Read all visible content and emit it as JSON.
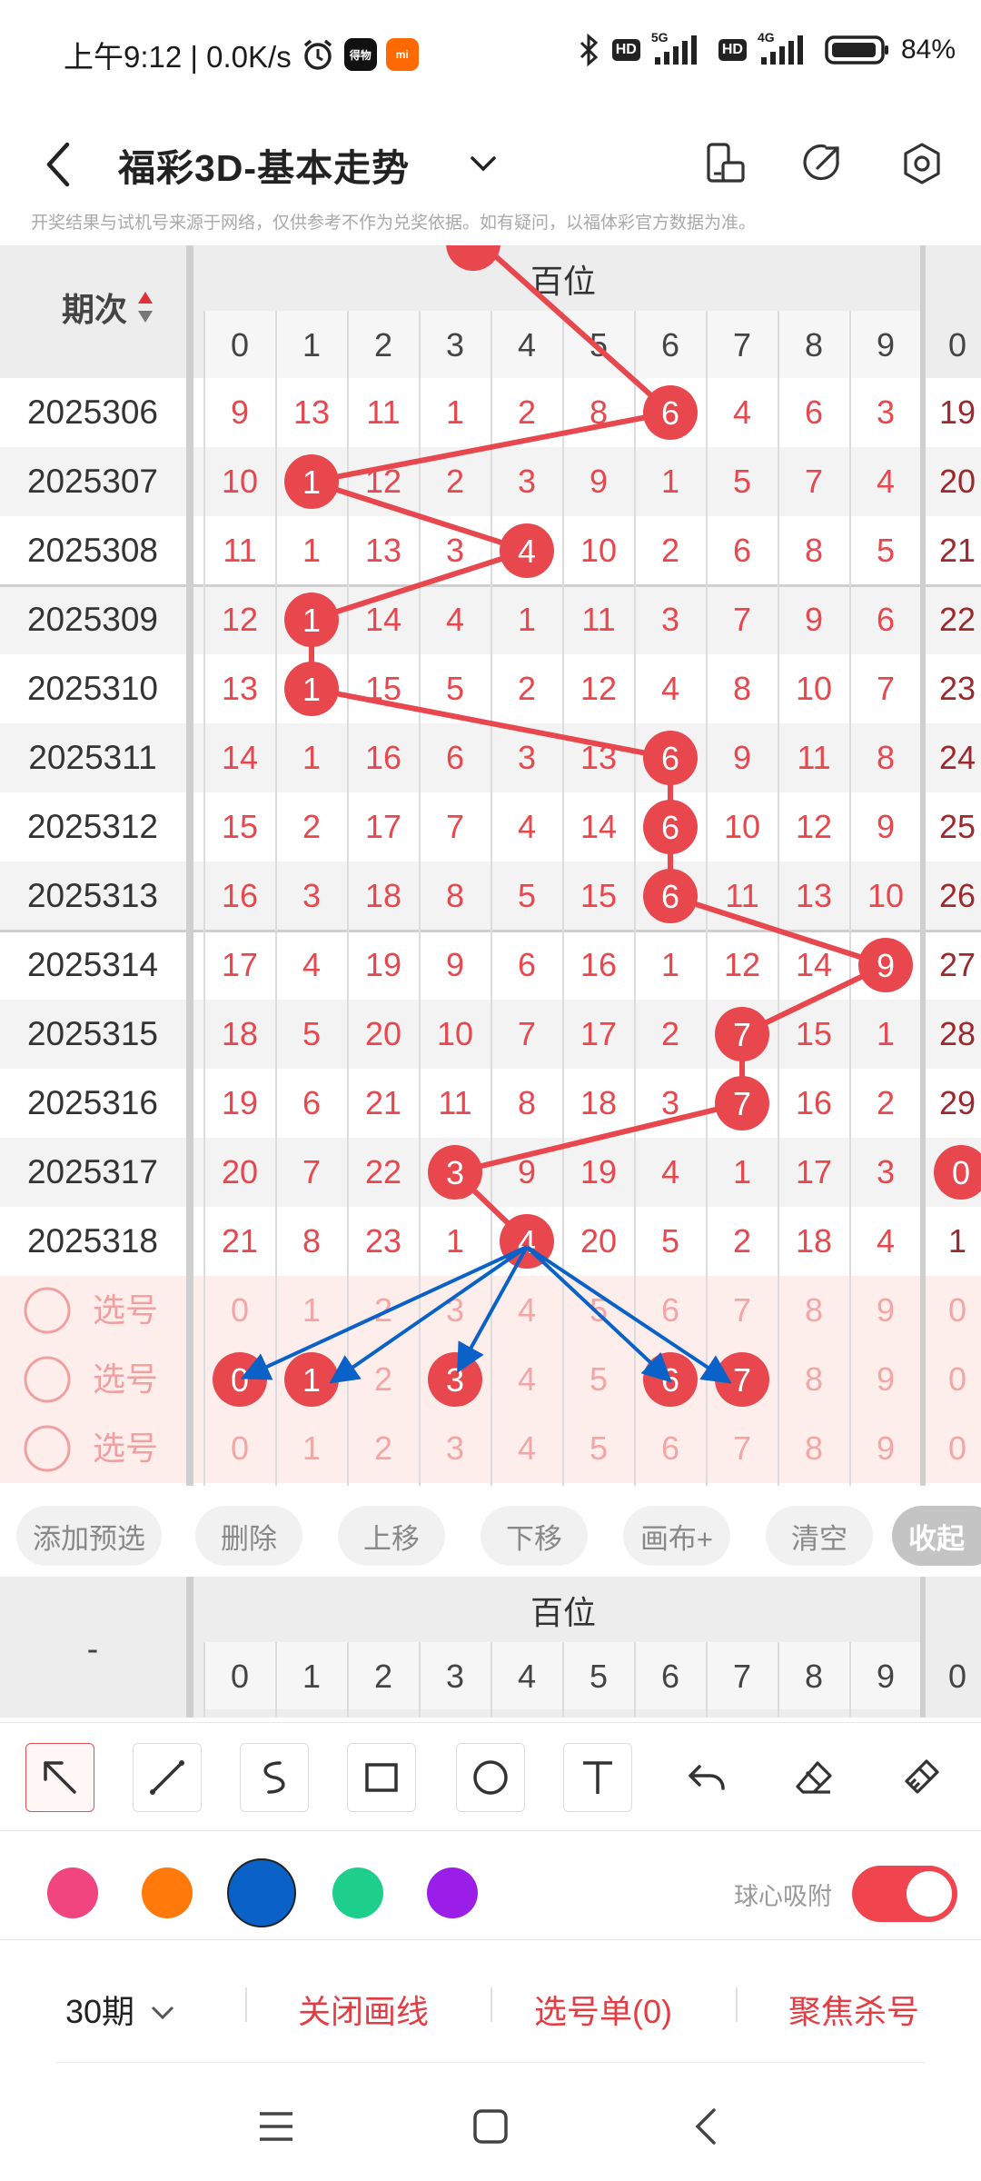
{
  "status": {
    "time": "上午9:12 | 0.0K/s",
    "app1": "得物",
    "app2": "mi",
    "net5g": "5G",
    "net4g": "4G",
    "hd": "HD",
    "battery": "84%"
  },
  "header": {
    "title": "福彩3D-基本走势"
  },
  "notice": "开奖结果与试机号来源于网络，仅供参考不作为兑奖依据。如有疑问，以福体彩官方数据为准。",
  "grid": {
    "period_label": "期次",
    "section_label": "百位",
    "digits": [
      "0",
      "1",
      "2",
      "3",
      "4",
      "5",
      "6",
      "7",
      "8",
      "9"
    ],
    "next_col_digit": "0",
    "rows": [
      {
        "p": "2025306",
        "v": [
          "9",
          "13",
          "11",
          "1",
          "2",
          "8",
          "6",
          "4",
          "6",
          "3"
        ],
        "hit": 6,
        "n": "19"
      },
      {
        "p": "2025307",
        "v": [
          "10",
          "1",
          "12",
          "2",
          "3",
          "9",
          "1",
          "5",
          "7",
          "4"
        ],
        "hit": 1,
        "n": "20"
      },
      {
        "p": "2025308",
        "v": [
          "11",
          "1",
          "13",
          "3",
          "4",
          "10",
          "2",
          "6",
          "8",
          "5"
        ],
        "hit": 4,
        "n": "21"
      },
      {
        "p": "2025309",
        "v": [
          "12",
          "1",
          "14",
          "4",
          "1",
          "11",
          "3",
          "7",
          "9",
          "6"
        ],
        "hit": 1,
        "n": "22"
      },
      {
        "p": "2025310",
        "v": [
          "13",
          "1",
          "15",
          "5",
          "2",
          "12",
          "4",
          "8",
          "10",
          "7"
        ],
        "hit": 1,
        "n": "23"
      },
      {
        "p": "2025311",
        "v": [
          "14",
          "1",
          "16",
          "6",
          "3",
          "13",
          "6",
          "9",
          "11",
          "8"
        ],
        "hit": 6,
        "n": "24"
      },
      {
        "p": "2025312",
        "v": [
          "15",
          "2",
          "17",
          "7",
          "4",
          "14",
          "6",
          "10",
          "12",
          "9"
        ],
        "hit": 6,
        "n": "25"
      },
      {
        "p": "2025313",
        "v": [
          "16",
          "3",
          "18",
          "8",
          "5",
          "15",
          "6",
          "11",
          "13",
          "10"
        ],
        "hit": 6,
        "n": "26"
      },
      {
        "p": "2025314",
        "v": [
          "17",
          "4",
          "19",
          "9",
          "6",
          "16",
          "1",
          "12",
          "14",
          "9"
        ],
        "hit": 9,
        "n": "27"
      },
      {
        "p": "2025315",
        "v": [
          "18",
          "5",
          "20",
          "10",
          "7",
          "17",
          "2",
          "7",
          "15",
          "1"
        ],
        "hit": 7,
        "n": "28"
      },
      {
        "p": "2025316",
        "v": [
          "19",
          "6",
          "21",
          "11",
          "8",
          "18",
          "3",
          "7",
          "16",
          "2"
        ],
        "hit": 7,
        "n": "29"
      },
      {
        "p": "2025317",
        "v": [
          "20",
          "7",
          "22",
          "3",
          "9",
          "19",
          "4",
          "1",
          "17",
          "3"
        ],
        "hit": 3,
        "n": "0"
      },
      {
        "p": "2025318",
        "v": [
          "21",
          "8",
          "23",
          "1",
          "4",
          "20",
          "5",
          "2",
          "18",
          "4"
        ],
        "hit": 4,
        "n": "1"
      }
    ],
    "select_label": "选号",
    "select_rows": [
      {
        "picked": []
      },
      {
        "picked": [
          0,
          1,
          3,
          6,
          7
        ]
      },
      {
        "picked": []
      }
    ],
    "select_next": "0"
  },
  "toolbar": {
    "add": "添加预选",
    "delete": "删除",
    "up": "上移",
    "down": "下移",
    "canvas": "画布+",
    "clear": "清空",
    "collapse": "收起"
  },
  "grid2": {
    "period_label": "-",
    "section_label": "百位"
  },
  "drawing": {
    "colors": [
      "#f0457f",
      "#ff7a0a",
      "#0a62c8",
      "#1ecf8c",
      "#9b1de8"
    ],
    "selected_color": "#0a62c8",
    "snap_label": "球心吸附",
    "snap_on": true
  },
  "bottom": {
    "periods": "30期",
    "close_lines": "关闭画线",
    "select_list": "选号单(0)",
    "focus_kill": "聚焦杀号"
  }
}
